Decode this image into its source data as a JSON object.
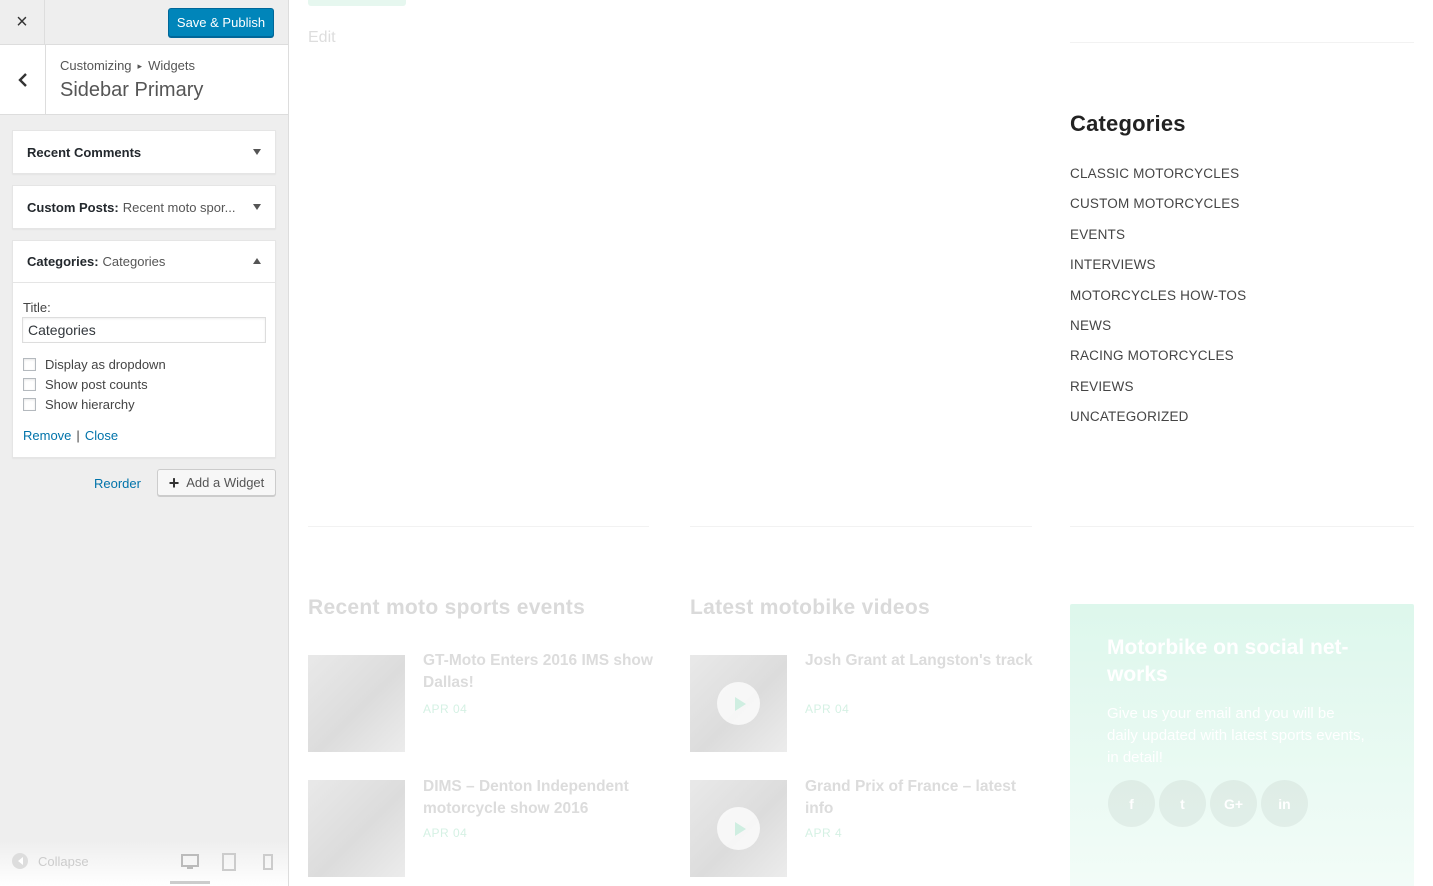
{
  "topbar": {
    "close_icon": "×",
    "save_label": "Save & Publish"
  },
  "section": {
    "breadcrumb_root": "Customizing",
    "breadcrumb_separator": "▸",
    "breadcrumb_current": "Widgets",
    "title": "Sidebar Primary"
  },
  "widgets": [
    {
      "name": "Recent Comments",
      "subtitle": "",
      "expanded": false
    },
    {
      "name": "Custom Posts:",
      "subtitle": "Recent moto spor...",
      "expanded": false
    },
    {
      "name": "Categories:",
      "subtitle": "Categories",
      "expanded": true
    }
  ],
  "category_form": {
    "title_label": "Title:",
    "title_value": "Categories",
    "options": [
      {
        "label": "Display as dropdown",
        "checked": false
      },
      {
        "label": "Show post counts",
        "checked": false
      },
      {
        "label": "Show hierarchy",
        "checked": false
      }
    ],
    "remove_label": "Remove",
    "pipe": "|",
    "close_label": "Close"
  },
  "sidebar_actions": {
    "reorder_label": "Reorder",
    "add_widget_plus": "+",
    "add_widget_label": "Add a Widget"
  },
  "footer": {
    "collapse_label": "Collapse",
    "devices": [
      "desktop-icon",
      "tablet-icon",
      "mobile-icon"
    ],
    "active_device": "desktop"
  },
  "preview": {
    "edit_label": "Edit",
    "categories_title": "Categories",
    "categories": [
      "CLASSIC MOTORCYCLES",
      "CUSTOM MOTORCYCLES",
      "EVENTS",
      "INTERVIEWS",
      "MOTORCYCLES HOW-TOS",
      "NEWS",
      "RACING MOTORCYCLES",
      "REVIEWS",
      "UNCATEGORIZED"
    ],
    "events_title": "Recent moto sports events",
    "events": [
      {
        "title": "GT-Moto Enters 2016 IMS show Dallas!",
        "date": "APR 04"
      },
      {
        "title": "DIMS – Denton Independent motorcycle show 2016",
        "date": "APR 04"
      }
    ],
    "videos_title": "Latest motobike videos",
    "videos": [
      {
        "title": "Josh Grant at Langston's track",
        "date": "APR 04"
      },
      {
        "title": "Grand Prix of France – latest info",
        "date": "APR 4"
      }
    ],
    "social": {
      "title": "Motorbike on social net-works",
      "text": "Give us your email and you will be daily updated with latest sports events, in detail!",
      "buttons": [
        "f",
        "t",
        "G+",
        "in"
      ]
    }
  },
  "colors": {
    "primary": "#0085ba",
    "link": "#0073aa",
    "accent_green": "#ddf7ec"
  }
}
